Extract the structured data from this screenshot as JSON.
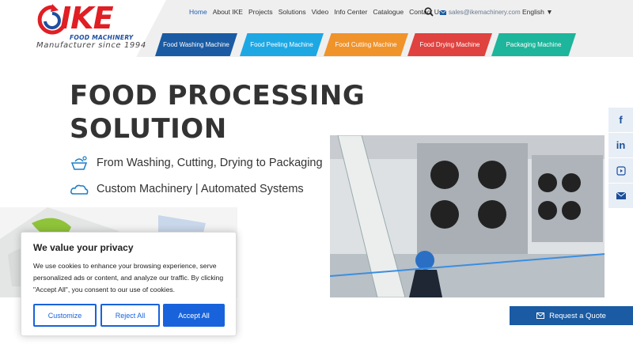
{
  "brand": {
    "name": "IKE",
    "subtitle": "FOOD MACHINERY",
    "tagline": "Manufacturer since 1994",
    "red": "#e01e24",
    "blue": "#1e4fa0"
  },
  "topnav": {
    "items": [
      "Home",
      "About IKE",
      "Projects",
      "Solutions",
      "Video",
      "Info Center",
      "Catalogue",
      "Contact Us"
    ],
    "active": "Home",
    "email": "sales@ikemachinery.com",
    "language": "English ▼"
  },
  "categories": [
    {
      "label": "Food Washing Machine",
      "color": "#1a5ba3"
    },
    {
      "label": "Food Peeling Machine",
      "color": "#1da8e4"
    },
    {
      "label": "Food Cutting Machine",
      "color": "#f0932b"
    },
    {
      "label": "Food Drying Machine",
      "color": "#e0423f"
    },
    {
      "label": "Packaging Machine",
      "color": "#1db59b"
    }
  ],
  "hero": {
    "title_line1": "FOOD PROCESSING",
    "title_line2": "SOLUTION",
    "feature1": "From Washing, Cutting, Drying to Packaging",
    "feature2": "Custom Machinery | Automated Systems"
  },
  "social": {
    "facebook": "f",
    "linkedin": "in",
    "youtube": "You Tube",
    "mail_icon": "mail-icon"
  },
  "quote": {
    "label": "Request a Quote"
  },
  "cookie": {
    "title": "We value your privacy",
    "text": "We use cookies to enhance your browsing experience, serve personalized ads or content, and analyze our traffic. By clicking \"Accept All\", you consent to our use of cookies.",
    "customize": "Customize",
    "reject": "Reject All",
    "accept": "Accept All",
    "accent": "#1863dc"
  }
}
